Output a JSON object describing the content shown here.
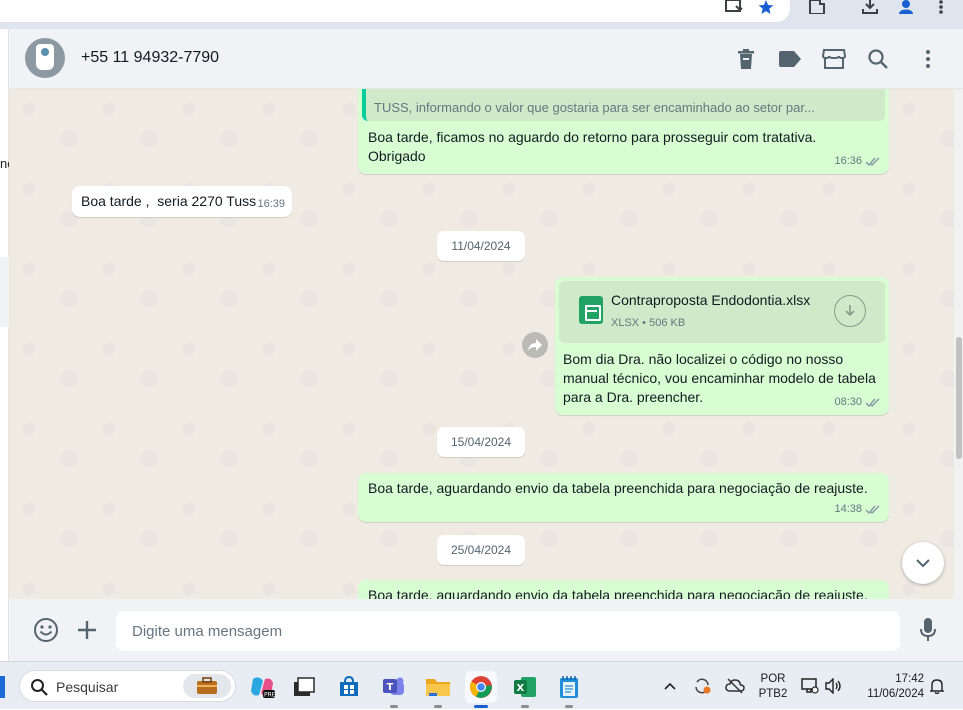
{
  "chat": {
    "contact_name": "+55 11 94932-7790",
    "quoted_text": "TUSS, informando o valor que gostaria para ser encaminhado ao setor par...",
    "messages": [
      {
        "direction": "out",
        "text": "Boa tarde, ficamos no aguardo do retorno para prosseguir com tratativa.\nObrigado",
        "time": "16:36",
        "status": "read"
      },
      {
        "direction": "in",
        "text": "Boa tarde ,  seria 2270 Tuss",
        "time": "16:39"
      },
      {
        "type": "date",
        "text": "11/04/2024"
      },
      {
        "direction": "out",
        "type": "document",
        "file_name": "Contraproposta Endodontia.xlsx",
        "file_meta": "XLSX • 506 KB",
        "text": "Bom dia Dra. não localizei o código no nosso manual técnico, vou encaminhar modelo de tabela para a Dra. preencher.",
        "time": "08:30",
        "status": "read"
      },
      {
        "type": "date",
        "text": "15/04/2024"
      },
      {
        "direction": "out",
        "text": "Boa tarde, aguardando envio da tabela preenchida para negociação de reajuste.",
        "time": "14:38",
        "status": "read"
      },
      {
        "type": "date",
        "text": "25/04/2024"
      },
      {
        "direction": "out",
        "text": "Boa tarde, aguardando envio da tabela preenchida para negociação de reajuste."
      }
    ]
  },
  "composer": {
    "placeholder": "Digite uma mensagem"
  },
  "sidebar_fragment": "ne",
  "taskbar": {
    "search_placeholder": "Pesquisar",
    "pinned_apps": [
      "copilot-icon",
      "task-view-icon",
      "store-icon",
      "teams-icon",
      "file-explorer-icon",
      "chrome-icon",
      "excel-icon",
      "notepad-icon"
    ],
    "active_app": "chrome-icon",
    "lang_line1": "POR",
    "lang_line2": "PTB2",
    "time": "17:42",
    "date": "11/06/2024"
  },
  "colors": {
    "outgoing_bubble": "#d9fdd3",
    "incoming_bubble": "#ffffff",
    "chat_background": "#efeae2",
    "header_bg": "#f0f2f5",
    "accent": "#06cf9c"
  }
}
